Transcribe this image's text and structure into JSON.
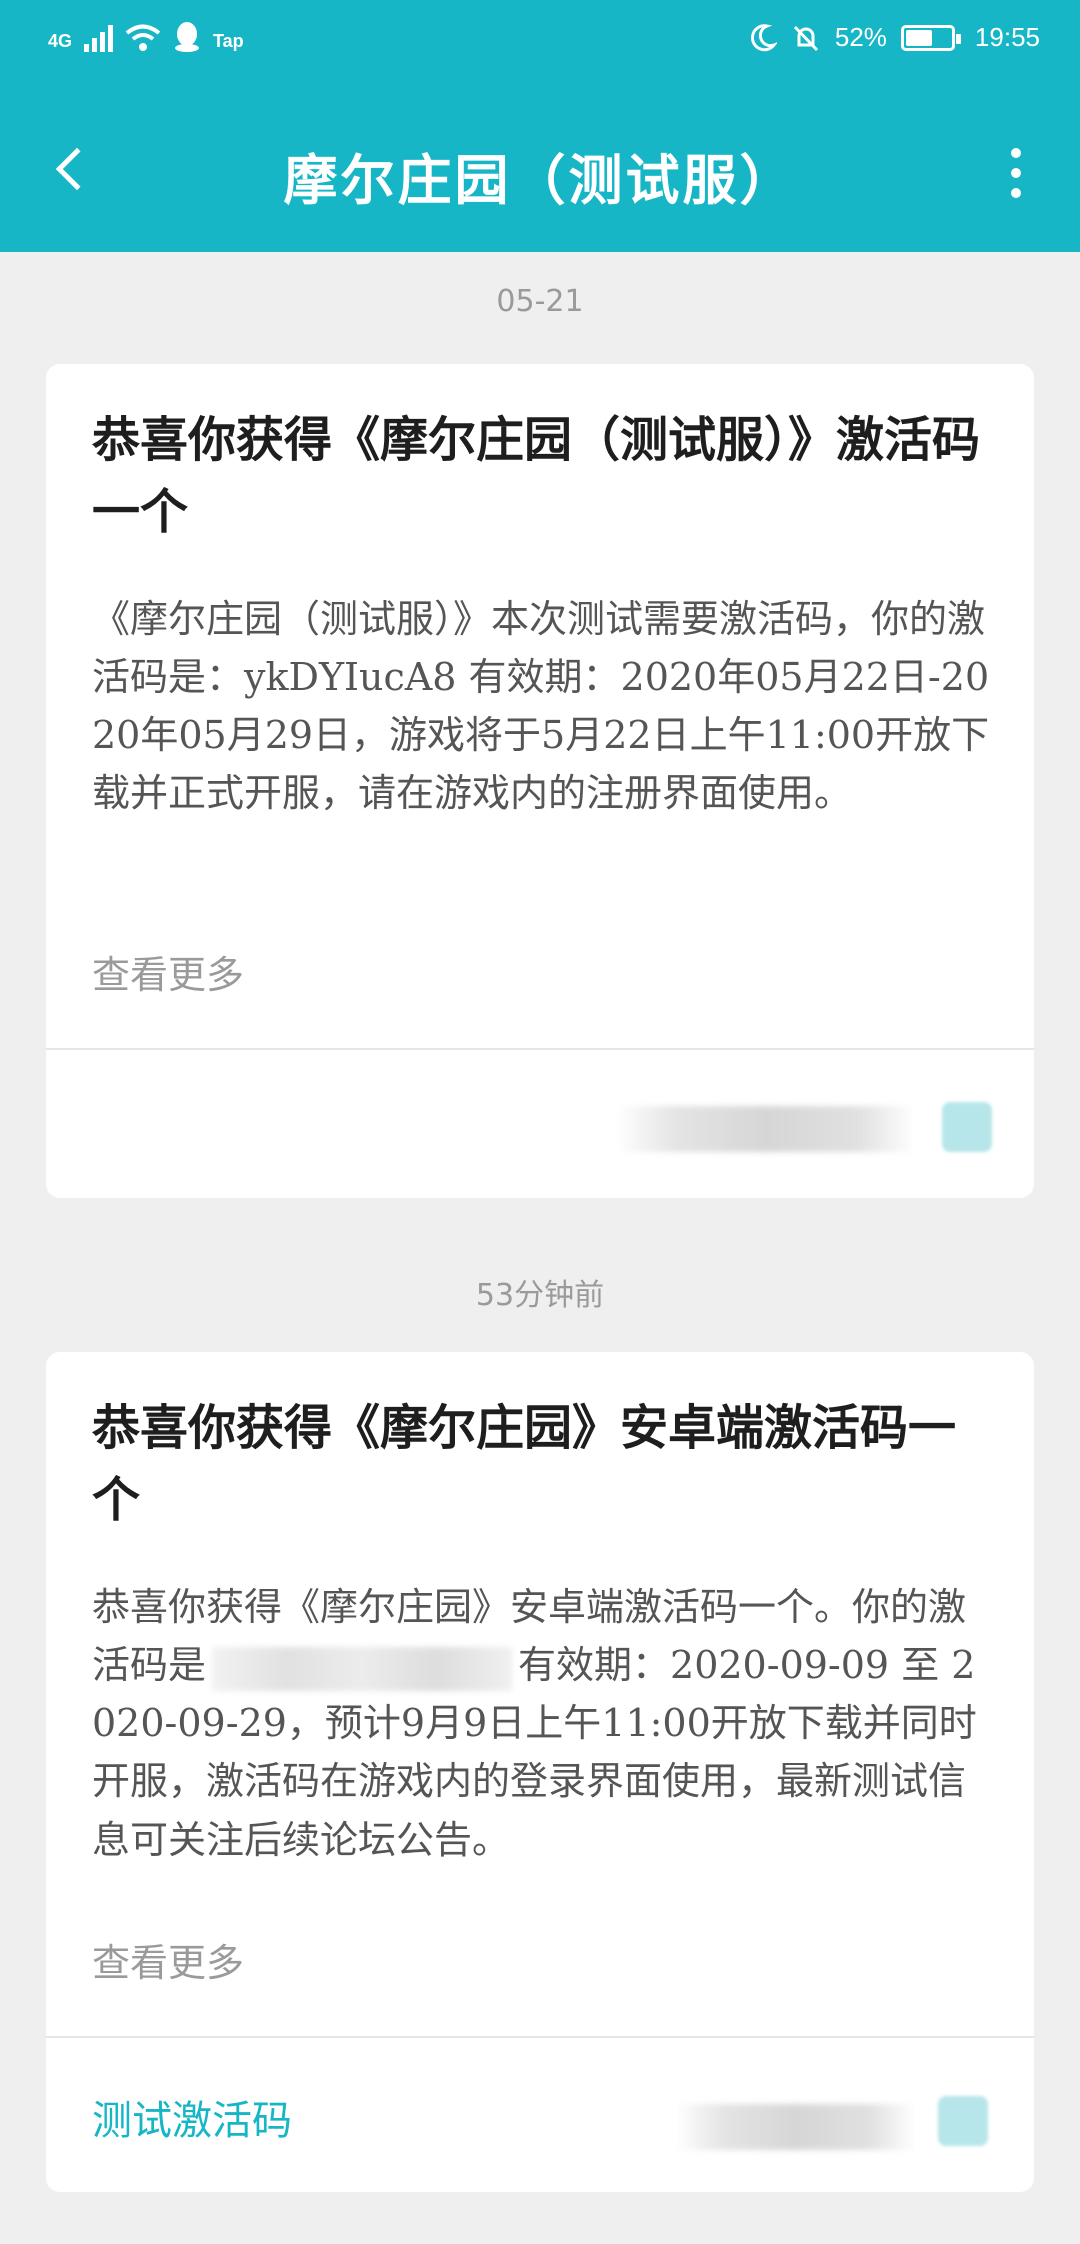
{
  "status_bar": {
    "network": "4G",
    "carrier_app": "Tap",
    "battery": "52%",
    "time": "19:55"
  },
  "app_bar": {
    "title": "摩尔庄园（测试服）"
  },
  "messages": [
    {
      "timestamp": "05-21",
      "title": "恭喜你获得《摩尔庄园（测试服）》激活码一个",
      "body": "《摩尔庄园（测试服）》本次测试需要激活码，你的激活码是：ykDYIucA8 有效期：2020年05月22日-2020年05月29日，游戏将于5月22日上午11:00开放下载并正式开服，请在游戏内的注册界面使用。",
      "more_label": "查看更多"
    },
    {
      "timestamp": "53分钟前",
      "title": "恭喜你获得《摩尔庄园》安卓端激活码一个",
      "body_before": "恭喜你获得《摩尔庄园》安卓端激活码一个。你的激活码是",
      "body_after": "有效期：2020-09-09 至 2020-09-29，预计9月9日上午11:00开放下载并同时开服，激活码在游戏内的登录界面使用，最新测试信息可关注后续论坛公告。",
      "more_label": "查看更多",
      "tag": "测试激活码"
    }
  ]
}
